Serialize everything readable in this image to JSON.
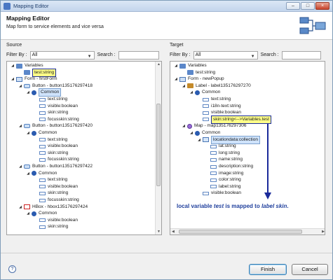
{
  "window": {
    "title": "Mapping Editor"
  },
  "header": {
    "title": "Mapping Editor",
    "description": "Map form to service elements and vice versa"
  },
  "source": {
    "label": "Source",
    "filter_label": "Filter By :",
    "filter_value": "All",
    "search_label": "Search :",
    "search_value": "",
    "tree": [
      {
        "label": "Variables",
        "depth": 0,
        "icon": "variables-icon"
      },
      {
        "label": "test:string",
        "depth": 1,
        "icon": "variable-icon",
        "highlight": true
      },
      {
        "label": "Form - firstForm",
        "depth": 0,
        "icon": "form-icon"
      },
      {
        "label": "Button - button135176297418",
        "depth": 1,
        "icon": "button-icon"
      },
      {
        "label": "Common",
        "depth": 2,
        "icon": "common-icon",
        "selected": true
      },
      {
        "label": "text:string",
        "depth": 3,
        "icon": "property-icon"
      },
      {
        "label": "visible:boolean",
        "depth": 3,
        "icon": "property-icon"
      },
      {
        "label": "skin:string",
        "depth": 3,
        "icon": "property-icon"
      },
      {
        "label": "focusskin:string",
        "depth": 3,
        "icon": "property-icon"
      },
      {
        "label": "Button - button135176297420",
        "depth": 1,
        "icon": "button-icon"
      },
      {
        "label": "Common",
        "depth": 2,
        "icon": "common-icon"
      },
      {
        "label": "text:string",
        "depth": 3,
        "icon": "property-icon"
      },
      {
        "label": "visible:boolean",
        "depth": 3,
        "icon": "property-icon"
      },
      {
        "label": "skin:string",
        "depth": 3,
        "icon": "property-icon"
      },
      {
        "label": "focusskin:string",
        "depth": 3,
        "icon": "property-icon"
      },
      {
        "label": "Button - button135176297422",
        "depth": 1,
        "icon": "button-icon"
      },
      {
        "label": "Common",
        "depth": 2,
        "icon": "common-icon"
      },
      {
        "label": "text:string",
        "depth": 3,
        "icon": "property-icon"
      },
      {
        "label": "visible:boolean",
        "depth": 3,
        "icon": "property-icon"
      },
      {
        "label": "skin:string",
        "depth": 3,
        "icon": "property-icon"
      },
      {
        "label": "focusskin:string",
        "depth": 3,
        "icon": "property-icon"
      },
      {
        "label": "HBox - hbox135176297424",
        "depth": 1,
        "icon": "hbox-icon"
      },
      {
        "label": "Common",
        "depth": 2,
        "icon": "common-icon"
      },
      {
        "label": "visible:boolean",
        "depth": 3,
        "icon": "property-icon"
      },
      {
        "label": "skin:string",
        "depth": 3,
        "icon": "property-icon"
      }
    ]
  },
  "target": {
    "label": "Target",
    "filter_label": "Filter By :",
    "filter_value": "All",
    "search_label": "Search :",
    "search_value": "",
    "tree": [
      {
        "label": "Variables",
        "depth": 0,
        "icon": "variables-icon"
      },
      {
        "label": "test:string",
        "depth": 1,
        "icon": "variable-icon"
      },
      {
        "label": "Form - newPopup",
        "depth": 0,
        "icon": "form-icon"
      },
      {
        "label": "Label - label135176297270",
        "depth": 1,
        "icon": "label-icon"
      },
      {
        "label": "Common",
        "depth": 2,
        "icon": "common-icon"
      },
      {
        "label": "text:string",
        "depth": 3,
        "icon": "property-icon"
      },
      {
        "label": "i18n-text:string",
        "depth": 3,
        "icon": "property-icon"
      },
      {
        "label": "visible:boolean",
        "depth": 3,
        "icon": "property-icon"
      },
      {
        "label": "skin:string<-->Variables.test",
        "depth": 3,
        "icon": "property-icon",
        "highlight": true
      },
      {
        "label": "Map - map135176297306",
        "depth": 1,
        "icon": "map-icon"
      },
      {
        "label": "Common",
        "depth": 2,
        "icon": "common-icon"
      },
      {
        "label": "locationdata:collection",
        "depth": 3,
        "icon": "collection-icon",
        "selected": true
      },
      {
        "label": "lat:string",
        "depth": 4,
        "icon": "property-icon"
      },
      {
        "label": "long:string",
        "depth": 4,
        "icon": "property-icon"
      },
      {
        "label": "name:string",
        "depth": 4,
        "icon": "property-icon"
      },
      {
        "label": "description:string",
        "depth": 4,
        "icon": "property-icon"
      },
      {
        "label": "image:string",
        "depth": 4,
        "icon": "property-icon"
      },
      {
        "label": "color:string",
        "depth": 4,
        "icon": "property-icon"
      },
      {
        "label": "label:string",
        "depth": 4,
        "icon": "property-icon"
      },
      {
        "label": "visible:boolean",
        "depth": 3,
        "icon": "property-icon"
      }
    ]
  },
  "annotation": {
    "prefix": "local variable ",
    "var_name": "test",
    "middle": " is mapped to ",
    "target_name": "label skin",
    "suffix": "."
  },
  "footer": {
    "help_label": "?",
    "finish_label": "Finish",
    "cancel_label": "Cancel"
  },
  "colors": {
    "highlight_bg": "#ffff88",
    "highlight_border": "#1a2a9a",
    "arrow": "#1a2a9a",
    "annotation": "#1f3f9c"
  }
}
